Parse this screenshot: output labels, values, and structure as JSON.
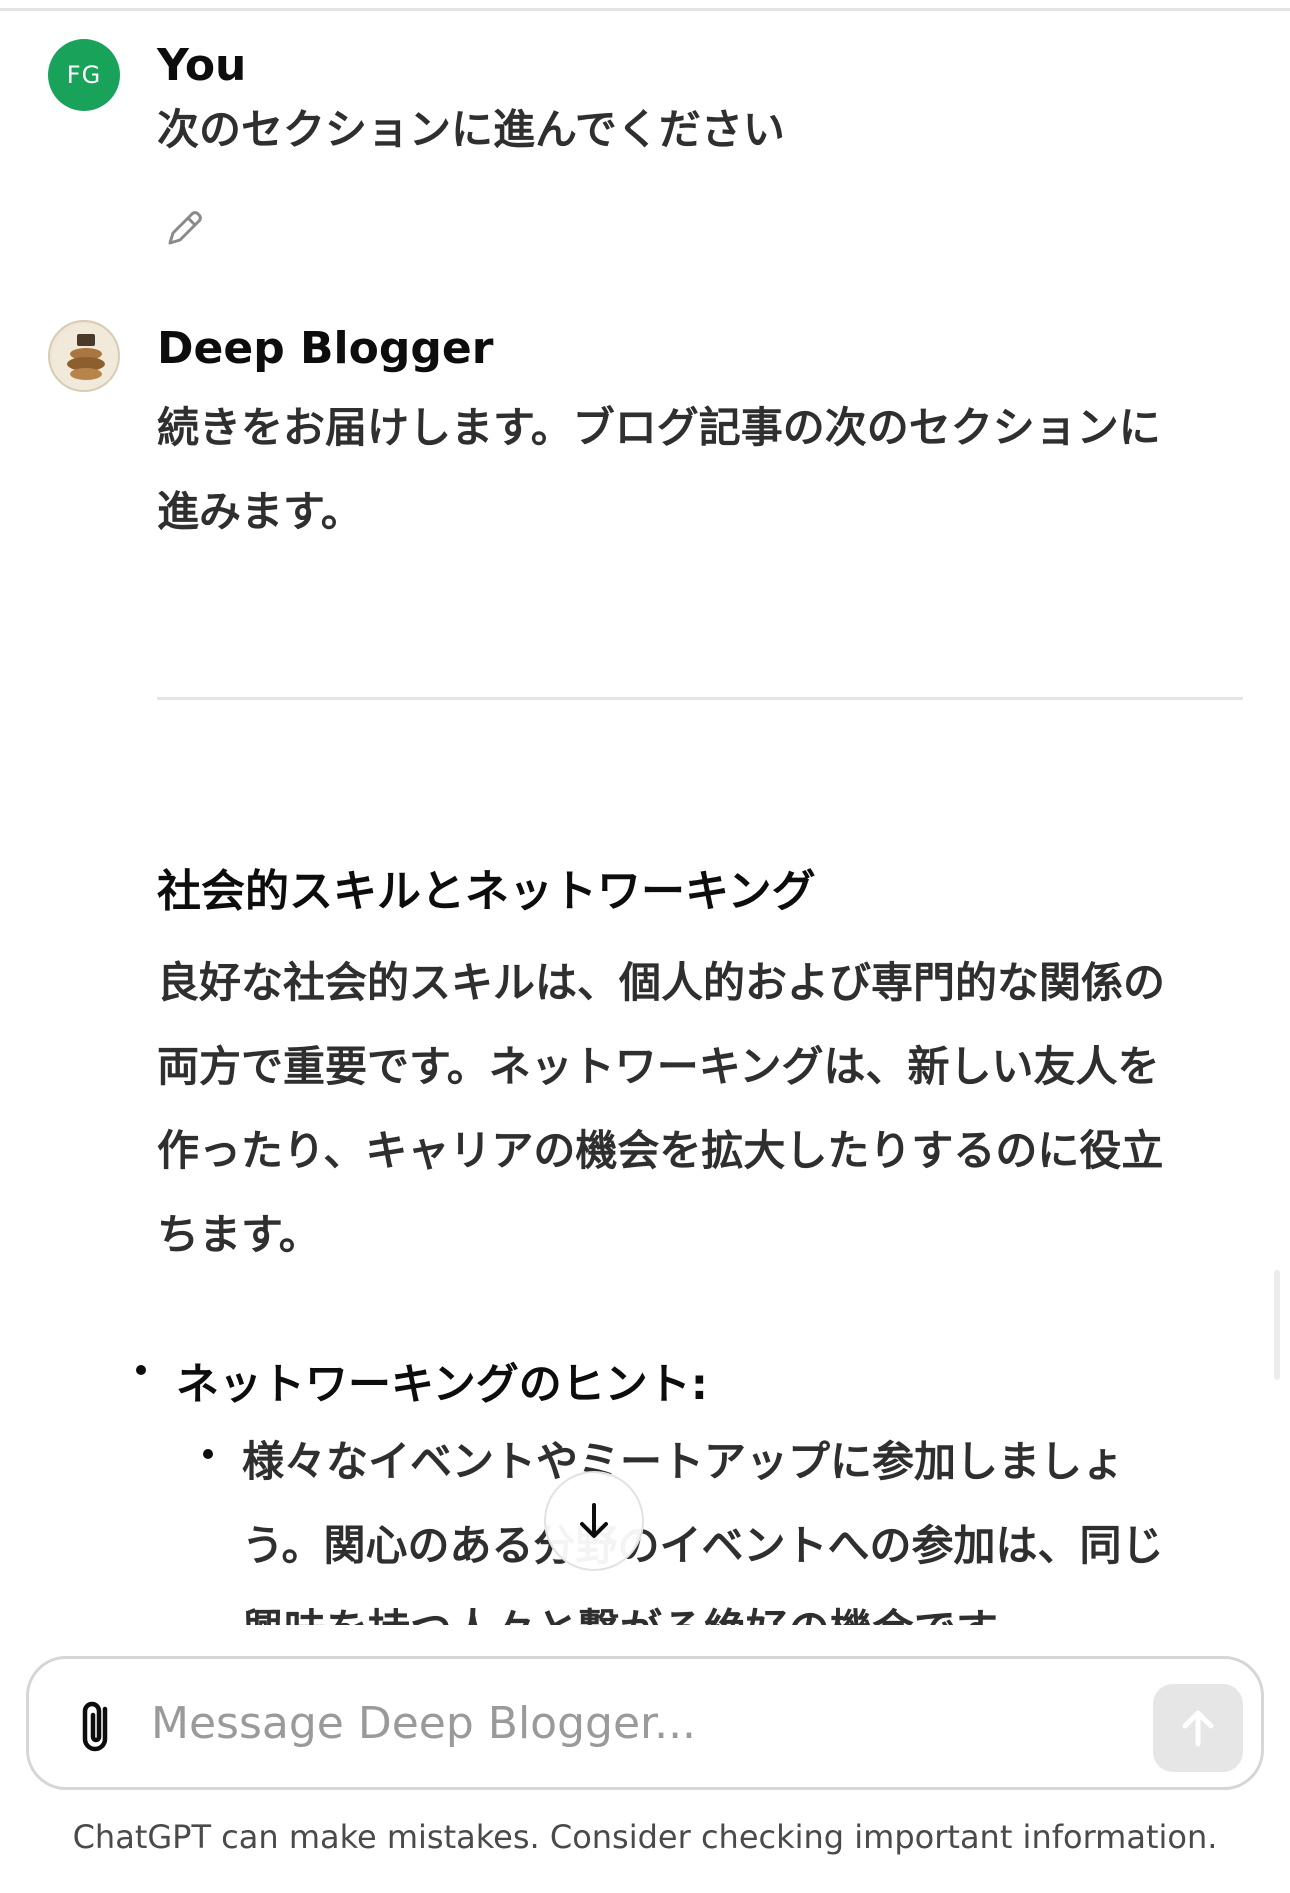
{
  "user_message": {
    "avatar_initials": "FG",
    "author": "You",
    "text": "次のセクションに進んでください"
  },
  "assistant_message": {
    "author": "Deep Blogger",
    "intro_lines": [
      "続きをお届けします。ブログ記事の次のセクションに",
      "進みます。"
    ],
    "section_heading": "社会的スキルとネットワーキング",
    "paragraph_lines": [
      "良好な社会的スキルは、個人的および専門的な関係の",
      "両方で重要です。ネットワーキングは、新しい友人を",
      "作ったり、キャリアの機会を拡大したりするのに役立",
      "ちます。"
    ],
    "list_title": "ネットワーキングのヒント:",
    "sub_item_lines": [
      "様々なイベントやミートアップに参加しましょ",
      "う。関心のある分野のイベントへの参加は、同じ",
      "興味を持つ人々と繋がる絶好の機会です。"
    ]
  },
  "composer": {
    "placeholder": "Message Deep Blogger..."
  },
  "footer": {
    "disclaimer": "ChatGPT can make mistakes. Consider checking important information."
  },
  "icons": {
    "edit": "pencil-icon",
    "attach": "paperclip-icon",
    "send": "arrow-up-icon",
    "scroll": "arrow-down-icon"
  },
  "colors": {
    "user_avatar": "#19a35a",
    "text": "#0d0d0d",
    "send_button_disabled": "#e6e6e6"
  }
}
